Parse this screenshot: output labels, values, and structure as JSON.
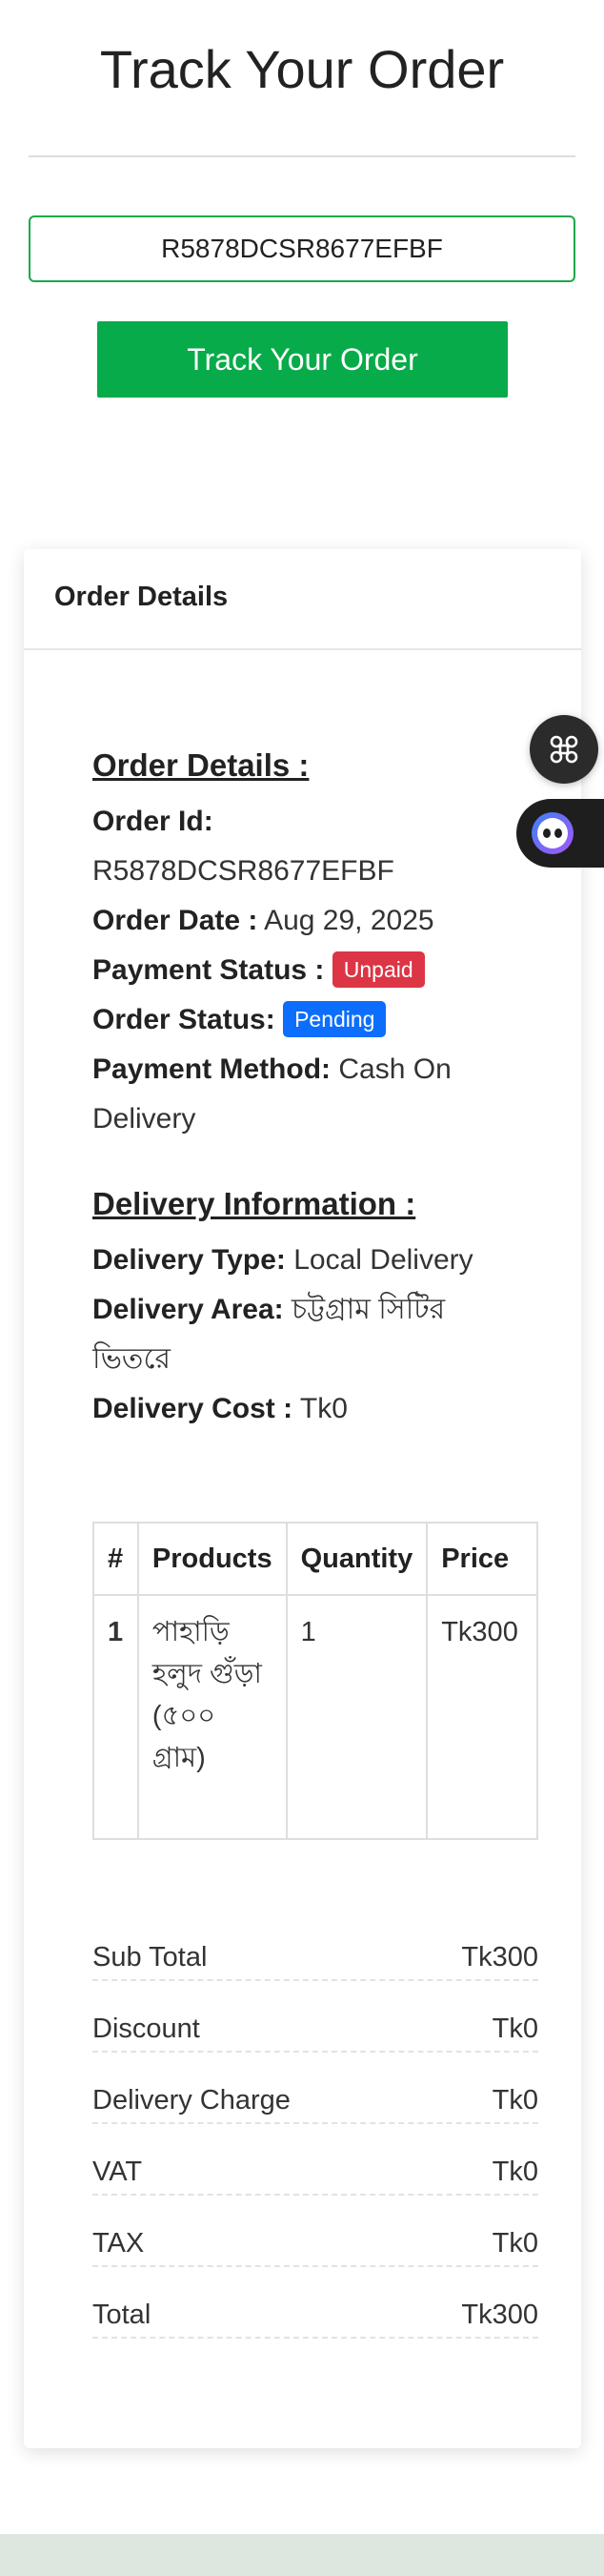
{
  "page": {
    "title": "Track Your Order"
  },
  "search": {
    "value": "R5878DCSR8677EFBF",
    "button_label": "Track Your Order"
  },
  "card": {
    "header": "Order Details",
    "order_section": {
      "heading": "Order Details :",
      "order_id_label": "Order Id:",
      "order_id": "R5878DCSR8677EFBF",
      "order_date_label": "Order Date :",
      "order_date": "Aug 29, 2025",
      "payment_status_label": "Payment Status :",
      "payment_status": "Unpaid",
      "order_status_label": "Order Status:",
      "order_status": "Pending",
      "payment_method_label": "Payment Method:",
      "payment_method": "Cash On Delivery"
    },
    "delivery_section": {
      "heading": "Delivery Information :",
      "type_label": "Delivery Type:",
      "type": "Local Delivery",
      "area_label": "Delivery Area:",
      "area": "চট্টগ্রাম সিটির ভিতরে",
      "cost_label": "Delivery Cost :",
      "cost": "Tk0"
    },
    "table": {
      "headers": [
        "#",
        "Products",
        "Quantity",
        "Price"
      ],
      "rows": [
        {
          "index": "1",
          "product": "পাহাড়ি হলুদ গুঁড়া (৫০০ গ্রাম)",
          "quantity": "1",
          "price": "Tk300"
        }
      ]
    },
    "summary": [
      {
        "label": "Sub Total",
        "value": "Tk300"
      },
      {
        "label": "Discount",
        "value": "Tk0"
      },
      {
        "label": "Delivery Charge",
        "value": "Tk0"
      },
      {
        "label": "VAT",
        "value": "Tk0"
      },
      {
        "label": "TAX",
        "value": "Tk0"
      },
      {
        "label": "Total",
        "value": "Tk300"
      }
    ]
  },
  "colors": {
    "accent_green": "#08ab49",
    "unpaid_badge": "#dc3545",
    "pending_badge": "#0d6efd"
  },
  "icons": {
    "floating_menu": "command-grid-icon",
    "assistant": "chatbot-icon"
  }
}
